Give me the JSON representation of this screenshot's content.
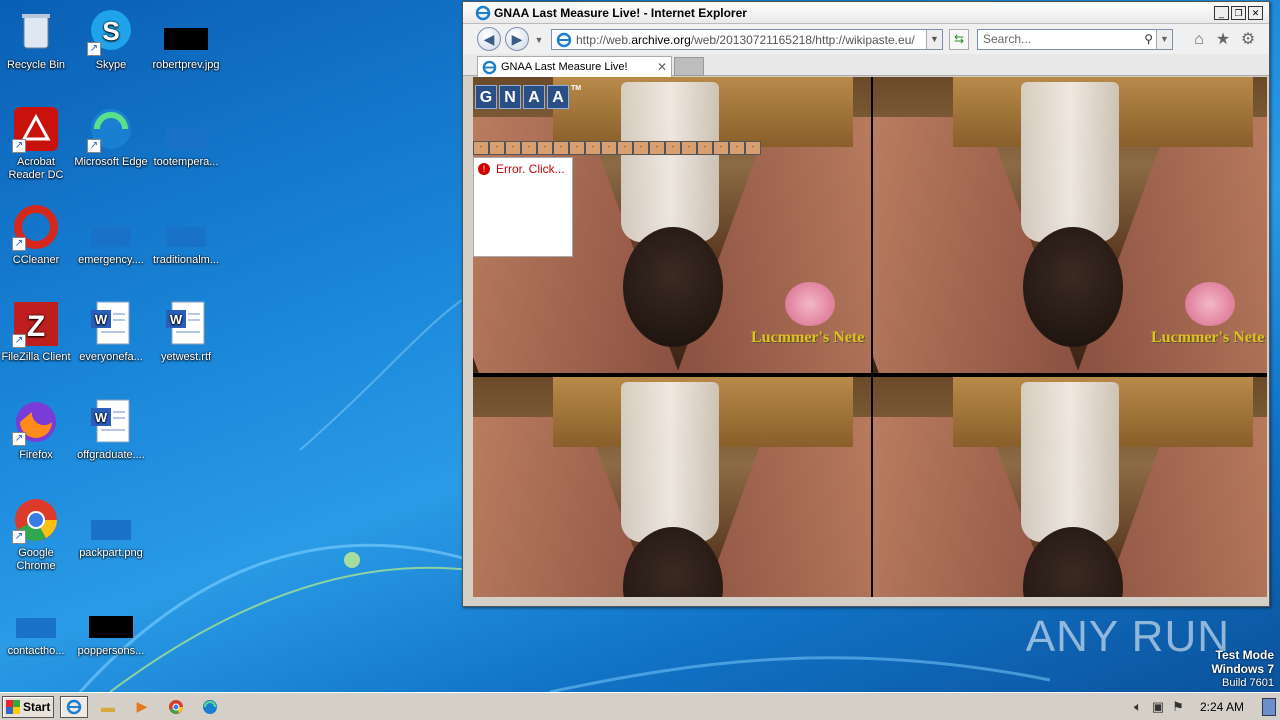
{
  "desktop": {
    "icons": [
      {
        "label": "Recycle Bin",
        "icon": "recycle-bin-icon"
      },
      {
        "label": "Skype",
        "icon": "skype-icon"
      },
      {
        "label": "robertprev.jpg",
        "icon": "image-file-icon"
      },
      {
        "label": "Acrobat Reader DC",
        "icon": "acrobat-icon"
      },
      {
        "label": "Microsoft Edge",
        "icon": "edge-icon"
      },
      {
        "label": "tootempera...",
        "icon": "file-icon"
      },
      {
        "label": "CCleaner",
        "icon": "ccleaner-icon"
      },
      {
        "label": "emergency....",
        "icon": "file-icon"
      },
      {
        "label": "traditionalm...",
        "icon": "file-icon"
      },
      {
        "label": "FileZilla Client",
        "icon": "filezilla-icon"
      },
      {
        "label": "everyonefa...",
        "icon": "word-doc-icon"
      },
      {
        "label": "yetwest.rtf",
        "icon": "word-doc-icon"
      },
      {
        "label": "Firefox",
        "icon": "firefox-icon"
      },
      {
        "label": "offgraduate....",
        "icon": "word-doc-icon"
      },
      {
        "label": "Google Chrome",
        "icon": "chrome-icon"
      },
      {
        "label": "packpart.png",
        "icon": "image-file-icon"
      },
      {
        "label": "contactho...",
        "icon": "file-icon"
      },
      {
        "label": "poppersons...",
        "icon": "image-file-icon"
      }
    ]
  },
  "browser": {
    "window_title": "GNAA Last Measure Live! - Internet Explorer",
    "address_prefix": "http://web.",
    "address_domain": "archive.org",
    "address_suffix": "/web/20130721165218/http://wikipaste.eu/",
    "search_placeholder": "Search...",
    "tab_label": "GNAA Last Measure Live!",
    "page": {
      "logo_letters": [
        "G",
        "N",
        "A",
        "A"
      ],
      "logo_tm": "TM",
      "error_text": "Error. Click...",
      "watermark_text": "Lucmmer's Nete"
    }
  },
  "taskbar": {
    "start_label": "Start",
    "clock": "2:24 AM"
  },
  "overlay": {
    "brand": "ANY RUN",
    "test_mode": "Test Mode",
    "os": "Windows 7",
    "build": "Build 7601"
  },
  "colors": {
    "desktop_blue": "#1a86d9",
    "error_red": "#cc0000",
    "logo_blue": "#2a4f86"
  }
}
